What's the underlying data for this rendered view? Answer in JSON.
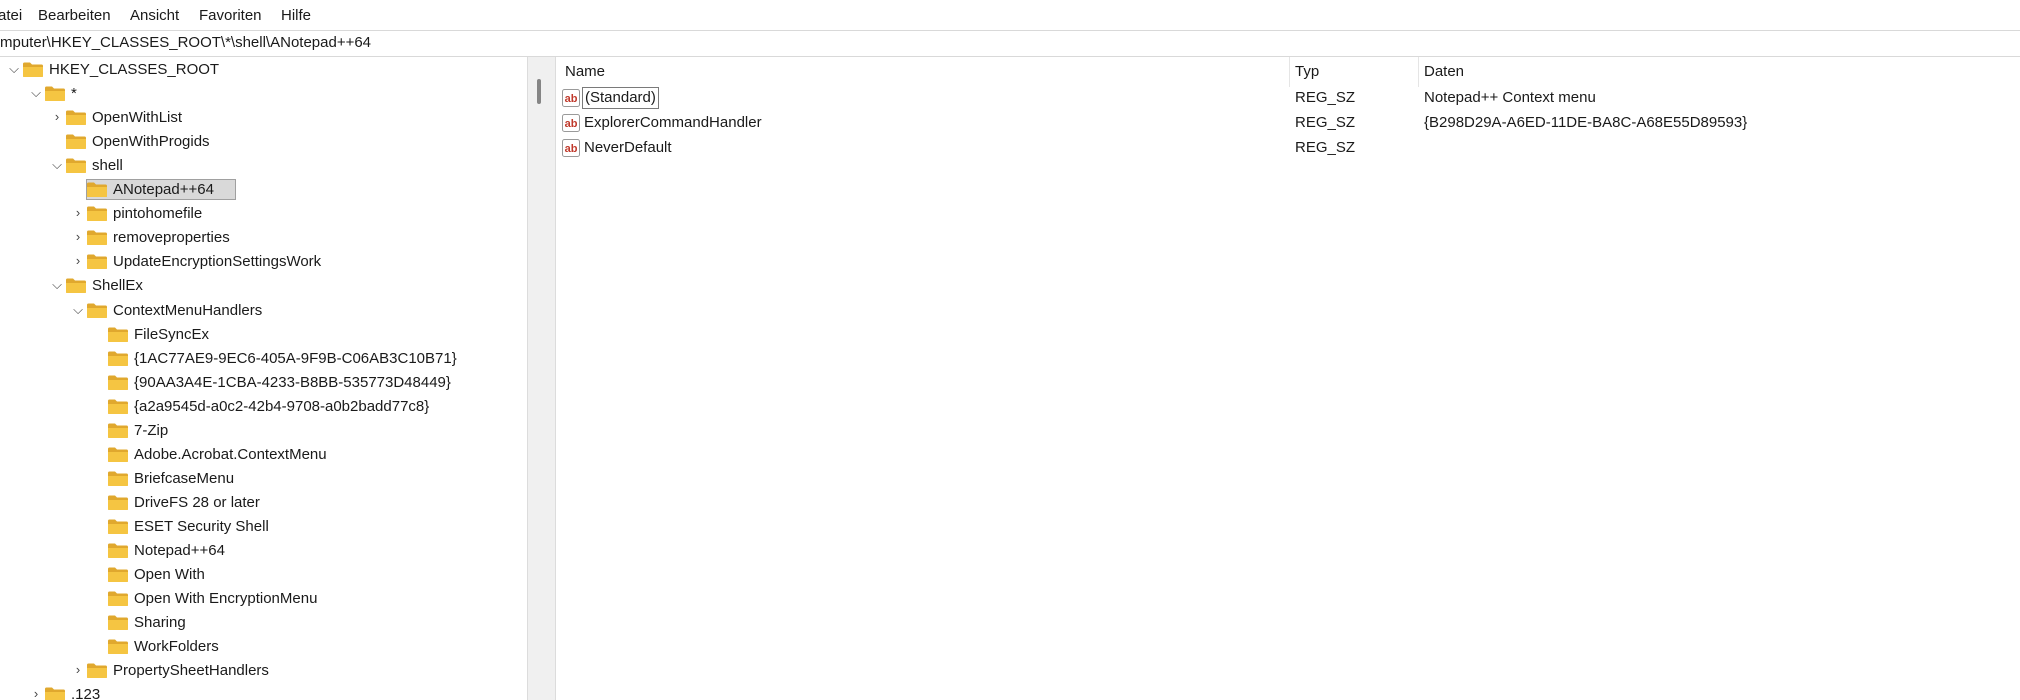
{
  "menu": {
    "file": "atei",
    "edit": "Bearbeiten",
    "view": "Ansicht",
    "favorites": "Favoriten",
    "help": "Hilfe"
  },
  "address": "mputer\\HKEY_CLASSES_ROOT\\*\\shell\\ANotepad++64",
  "tree": [
    {
      "label": "HKEY_CLASSES_ROOT",
      "level": 0,
      "chevron": "expanded"
    },
    {
      "label": "*",
      "level": 1,
      "chevron": "expanded"
    },
    {
      "label": "OpenWithList",
      "level": 2,
      "chevron": "collapsed"
    },
    {
      "label": "OpenWithProgids",
      "level": 2,
      "chevron": "none"
    },
    {
      "label": "shell",
      "level": 2,
      "chevron": "expanded"
    },
    {
      "label": "ANotepad++64",
      "level": 3,
      "chevron": "none",
      "selected": true
    },
    {
      "label": "pintohomefile",
      "level": 3,
      "chevron": "collapsed"
    },
    {
      "label": "removeproperties",
      "level": 3,
      "chevron": "collapsed"
    },
    {
      "label": "UpdateEncryptionSettingsWork",
      "level": 3,
      "chevron": "collapsed"
    },
    {
      "label": "ShellEx",
      "level": 2,
      "chevron": "expanded"
    },
    {
      "label": "ContextMenuHandlers",
      "level": 3,
      "chevron": "expanded"
    },
    {
      "label": " FileSyncEx",
      "level": 4,
      "chevron": "none"
    },
    {
      "label": "{1AC77AE9-9EC6-405A-9F9B-C06AB3C10B71}",
      "level": 4,
      "chevron": "none"
    },
    {
      "label": "{90AA3A4E-1CBA-4233-B8BB-535773D48449}",
      "level": 4,
      "chevron": "none"
    },
    {
      "label": "{a2a9545d-a0c2-42b4-9708-a0b2badd77c8}",
      "level": 4,
      "chevron": "none"
    },
    {
      "label": "7-Zip",
      "level": 4,
      "chevron": "none"
    },
    {
      "label": "Adobe.Acrobat.ContextMenu",
      "level": 4,
      "chevron": "none"
    },
    {
      "label": "BriefcaseMenu",
      "level": 4,
      "chevron": "none"
    },
    {
      "label": "DriveFS 28 or later",
      "level": 4,
      "chevron": "none"
    },
    {
      "label": "ESET Security Shell",
      "level": 4,
      "chevron": "none"
    },
    {
      "label": "Notepad++64",
      "level": 4,
      "chevron": "none"
    },
    {
      "label": "Open With",
      "level": 4,
      "chevron": "none"
    },
    {
      "label": "Open With EncryptionMenu",
      "level": 4,
      "chevron": "none"
    },
    {
      "label": "Sharing",
      "level": 4,
      "chevron": "none"
    },
    {
      "label": "WorkFolders",
      "level": 4,
      "chevron": "none"
    },
    {
      "label": "PropertySheetHandlers",
      "level": 3,
      "chevron": "collapsed"
    },
    {
      "label": ".123",
      "level": 1,
      "chevron": "collapsed"
    }
  ],
  "columns": {
    "name": "Name",
    "type": "Typ",
    "data": "Daten"
  },
  "values": [
    {
      "name": "(Standard)",
      "type": "REG_SZ",
      "data": "Notepad++ Context menu",
      "focused": true
    },
    {
      "name": "ExplorerCommandHandler",
      "type": "REG_SZ",
      "data": "{B298D29A-A6ED-11DE-BA8C-A68E55D89593}"
    },
    {
      "name": "NeverDefault",
      "type": "REG_SZ",
      "data": ""
    }
  ],
  "colors": {
    "folder": "#f5c542",
    "folder_dark": "#e0a82e",
    "selection_bg": "#d9d9d9",
    "string_icon_red": "#c0392b"
  },
  "icons": {
    "folder": "folder-icon",
    "string_value": "reg-sz-icon",
    "expand": "chevron-down-icon",
    "collapse": "chevron-right-icon"
  }
}
